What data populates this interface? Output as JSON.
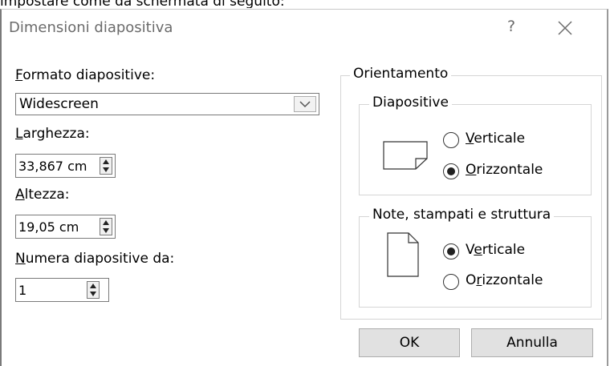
{
  "caption": "impostare come da schermata di seguito:",
  "dialog": {
    "title": "Dimensioni diapositiva",
    "help_symbol": "?",
    "close_symbol": "×"
  },
  "slide_size": {
    "label": "ormato diapositive:",
    "label_mnemonic": "F",
    "value": "Widescreen"
  },
  "width": {
    "label": "arghezza:",
    "label_mnemonic": "L",
    "value": "33,867 cm"
  },
  "height": {
    "label": "ltezza:",
    "label_mnemonic": "A",
    "value": "19,05 cm"
  },
  "numbering": {
    "label": "umera diapositive da:",
    "label_mnemonic": "N",
    "value": "1"
  },
  "orientation": {
    "title": "Orientamento",
    "slides": {
      "title": "Diapositive",
      "options": [
        {
          "pre": "",
          "mn": "V",
          "post": "erticale",
          "selected": false
        },
        {
          "pre": "",
          "mn": "O",
          "post": "rizzontale",
          "selected": true
        }
      ]
    },
    "notes": {
      "title": "Note, stampati e struttura",
      "options": [
        {
          "pre": "V",
          "mn": "e",
          "post": "rticale",
          "selected": true
        },
        {
          "pre": "O",
          "mn": "r",
          "post": "izzontale",
          "selected": false
        }
      ]
    }
  },
  "buttons": {
    "ok": "OK",
    "cancel": "Annulla"
  }
}
